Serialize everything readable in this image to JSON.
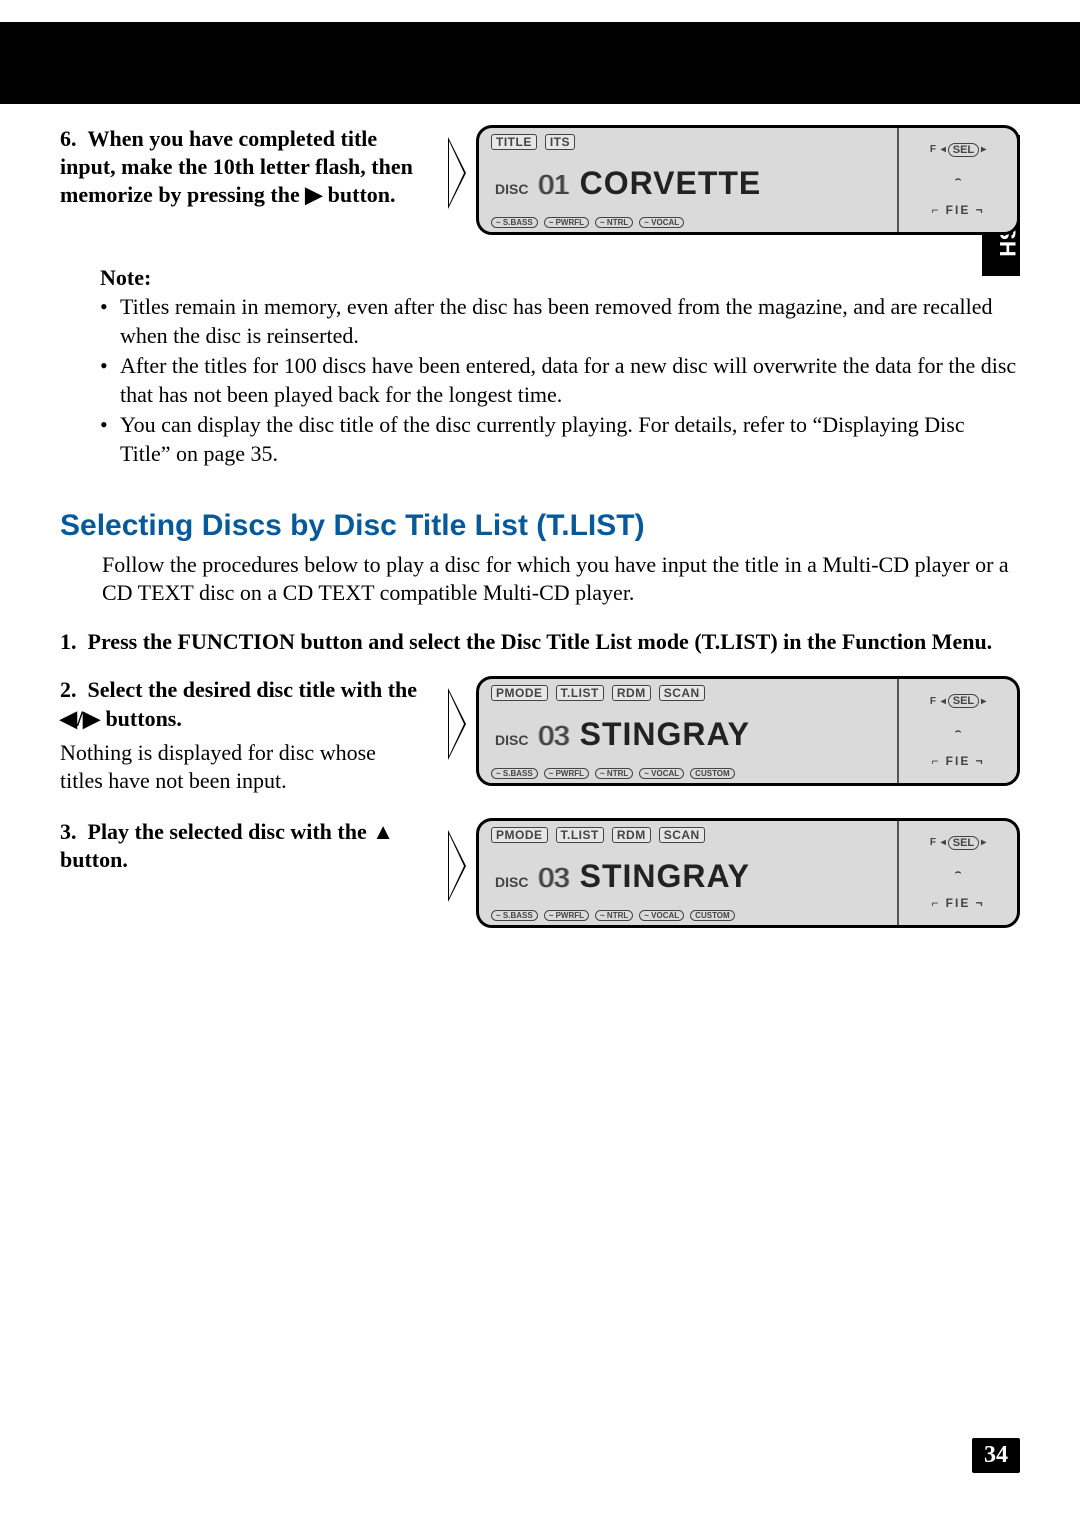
{
  "lang_tab": "ENGLISH",
  "page_number": "34",
  "step6": {
    "num": "6.",
    "text": "When you have completed title input, make the 10th letter flash, then memorize by pressing the ▶ button.",
    "display": {
      "top_tags": [
        "TITLE",
        "ITS"
      ],
      "disc_label": "DISC",
      "disc_num": "01",
      "title": "CORVETTE",
      "bottom_pills": [
        "~ S.BASS",
        "~ PWRFL",
        "~ NTRL",
        "~ VOCAL"
      ],
      "right": {
        "f": "F",
        "sel": "SEL",
        "fie": "FIE"
      }
    }
  },
  "note": {
    "label": "Note:",
    "items": [
      "Titles remain in memory, even after the disc has been removed from the magazine, and are recalled when the disc is reinserted.",
      "After the titles for 100 discs have been entered, data for a new disc will overwrite the data for the disc that has not been played back for the longest time.",
      "You can display the disc title of the disc currently playing. For details, refer to “Displaying Disc Title” on page 35."
    ]
  },
  "section": {
    "heading": "Selecting Discs by Disc Title List (T.LIST)",
    "intro": "Follow the procedures below to play a disc for which you have input the title in a Multi-CD player or a CD TEXT disc on a CD TEXT compatible Multi-CD player."
  },
  "step1": {
    "num": "1.",
    "text": "Press the FUNCTION button and select the Disc Title List mode (T.LIST) in the Function Menu."
  },
  "step2": {
    "num": "2.",
    "text": "Select the desired disc title with the ◀/▶ buttons.",
    "sub": "Nothing is displayed for disc whose titles have not been input.",
    "display": {
      "top_tags": [
        "PMODE",
        "T.LIST",
        "RDM",
        "SCAN"
      ],
      "disc_label": "DISC",
      "disc_num": "03",
      "title": "STINGRAY",
      "bottom_pills": [
        "~ S.BASS",
        "~ PWRFL",
        "~ NTRL",
        "~ VOCAL",
        "CUSTOM"
      ],
      "right": {
        "f": "F",
        "sel": "SEL",
        "fie": "FIE"
      }
    }
  },
  "step3": {
    "num": "3.",
    "text": "Play the selected disc with the ▲ button.",
    "display": {
      "top_tags": [
        "PMODE",
        "T.LIST",
        "RDM",
        "SCAN"
      ],
      "disc_label": "DISC",
      "disc_num": "03",
      "title": "STINGRAY",
      "bottom_pills": [
        "~ S.BASS",
        "~ PWRFL",
        "~ NTRL",
        "~ VOCAL",
        "CUSTOM"
      ],
      "right": {
        "f": "F",
        "sel": "SEL",
        "fie": "FIE"
      }
    }
  }
}
